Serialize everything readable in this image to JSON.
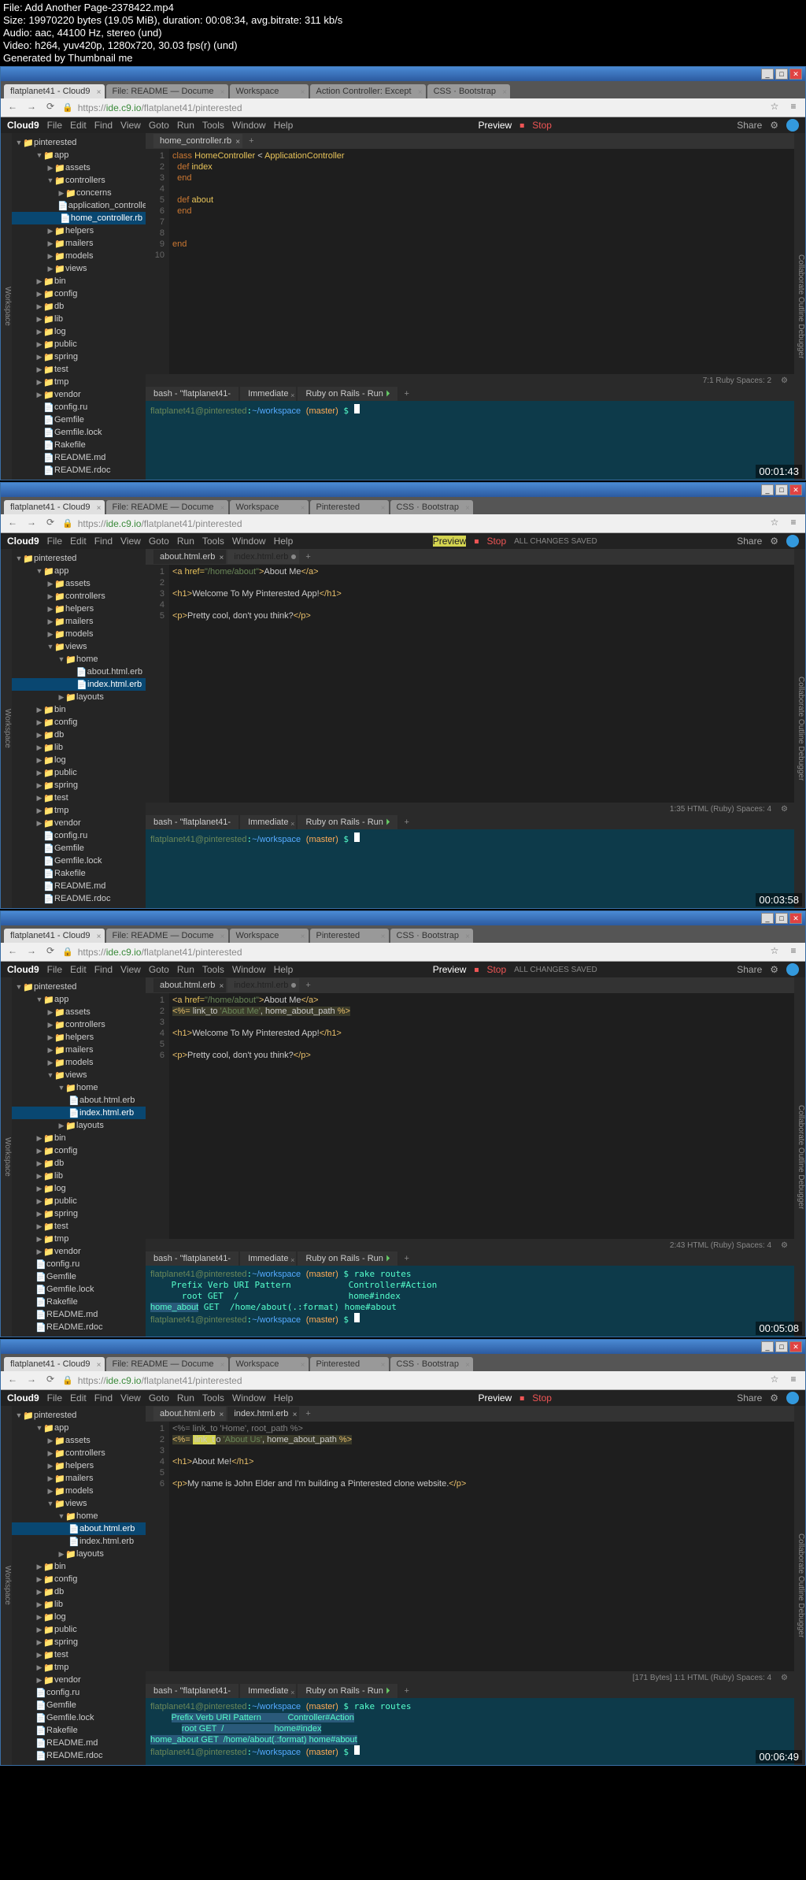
{
  "fileinfo": {
    "l1": "File: Add Another Page-2378422.mp4",
    "l2": "Size: 19970220 bytes (19.05 MiB), duration: 00:08:34, avg.bitrate: 311 kb/s",
    "l3": "Audio: aac, 44100 Hz, stereo (und)",
    "l4": "Video: h264, yuv420p, 1280x720, 30.03 fps(r) (und)",
    "l5": "Generated by Thumbnail me"
  },
  "common": {
    "browsertabs": [
      {
        "label": "flatplanet41 - Cloud9"
      },
      {
        "label": "File: README — Docume"
      },
      {
        "label": "Workspace"
      },
      {
        "label": "Action Controller: Except"
      },
      {
        "label": "CSS · Bootstrap"
      }
    ],
    "browsertabs_b": [
      {
        "label": "flatplanet41 - Cloud9"
      },
      {
        "label": "File: README — Docume"
      },
      {
        "label": "Workspace"
      },
      {
        "label": "Pinterested"
      },
      {
        "label": "CSS · Bootstrap"
      }
    ],
    "url_prefix": "https://",
    "url_host": "ide.c9.io",
    "url_path": "/flatplanet41/pinterested",
    "menu": [
      "File",
      "Edit",
      "Find",
      "View",
      "Goto",
      "Run",
      "Tools",
      "Window",
      "Help"
    ],
    "logo": "Cloud9",
    "preview": "Preview",
    "run": "Run",
    "stop": "Stop",
    "share": "Share",
    "saved": "ALL CHANGES SAVED ",
    "winbtns": {
      "min": "_",
      "max": "□",
      "close": "✕"
    }
  },
  "tree": {
    "root": "pinterested",
    "app": "app",
    "assets": "assets",
    "controllers": "controllers",
    "concerns": "concerns",
    "appctrl": "application_controlle",
    "homectrl": "home_controller.rb",
    "helpers": "helpers",
    "mailers": "mailers",
    "models": "models",
    "views": "views",
    "home": "home",
    "about_erb": "about.html.erb",
    "index_erb": "index.html.erb",
    "layouts": "layouts",
    "bin": "bin",
    "config": "config",
    "db": "db",
    "lib": "lib",
    "log": "log",
    "public": "public",
    "spring": "spring",
    "test": "test",
    "tmp": "tmp",
    "vendor": "vendor",
    "configru": "config.ru",
    "gemfile": "Gemfile",
    "gemlock": "Gemfile.lock",
    "rakefile": "Rakefile",
    "readmemd": "README.md",
    "readmerdoc": "README.rdoc"
  },
  "f1": {
    "timestamp": "00:01:43",
    "edtab": "home_controller.rb",
    "code": {
      "1": "class HomeController < ApplicationController",
      "2": "  def index",
      "3": "  end",
      "4": "",
      "5": "  def about",
      "6": "  end",
      "7": "",
      "8": "",
      "9": "end",
      "10": ""
    },
    "status": "7:1   Ruby   Spaces: 2",
    "termtabs": [
      "bash - \"flatplanet41-",
      "Immediate",
      "Ruby on Rails - Run"
    ],
    "term": "flatplanet41@pinterested:~/workspace (master) $ "
  },
  "f2": {
    "timestamp": "00:03:58",
    "edtabs": [
      "about.html.erb",
      "index.html.erb"
    ],
    "code": {
      "1": "<a href=\"/home/about\">About Me</a>",
      "2": "",
      "3": "<h1>Welcome To My Pinterested App!</h1>",
      "4": "",
      "5": "<p>Pretty cool, don't you think?</p>"
    },
    "status": "1:35   HTML (Ruby)   Spaces: 4",
    "termtabs": [
      "bash - \"flatplanet41-",
      "Immediate",
      "Ruby on Rails - Run"
    ],
    "term": "flatplanet41@pinterested:~/workspace (master) $ "
  },
  "f3": {
    "timestamp": "00:05:08",
    "edtabs": [
      "about.html.erb",
      "index.html.erb"
    ],
    "code": {
      "1": "<a href=\"/home/about\">About Me</a>",
      "2": "<%= link_to 'About Me', home_about_path %>",
      "3": "",
      "4": "<h1>Welcome To My Pinterested App!</h1>",
      "5": "",
      "6": "<p>Pretty cool, don't you think?</p>"
    },
    "status": "2:43   HTML (Ruby)   Spaces: 4",
    "termtabs": [
      "bash - \"flatplanet41-",
      "Immediate",
      "Ruby on Rails - Run"
    ],
    "term": {
      "l1": "flatplanet41@pinterested:~/workspace (master) $ rake routes",
      "l2": "    Prefix Verb URI Pattern           Controller#Action",
      "l3": "      root GET  /                     home#index",
      "l4": "home_about GET  /home/about(.:format) home#about",
      "l5": "flatplanet41@pinterested:~/workspace (master) $ "
    }
  },
  "f4": {
    "timestamp": "00:06:49",
    "edtabs": [
      "about.html.erb",
      "index.html.erb"
    ],
    "code": {
      "1": "<%= link_to 'Home', root_path %>",
      "2": "<%= link_to 'About Us', home_about_path %>",
      "3": "",
      "4": "<h1>About Me!</h1>",
      "5": "",
      "6": "<p>My name is John Elder and I'm building a Pinterested clone website.</p>"
    },
    "status": "[171 Bytes]   1:1   HTML (Ruby)   Spaces: 4",
    "termtabs": [
      "bash - \"flatplanet41-",
      "Immediate",
      "Ruby on Rails - Run"
    ],
    "term": {
      "l1": "flatplanet41@pinterested:~/workspace (master) $ rake routes",
      "l2": "    Prefix Verb URI Pattern           Controller#Action",
      "l3": "      root GET  /                     home#index",
      "l4": "home_about GET  /home/about(.:format) home#about",
      "l5": "flatplanet41@pinterested:~/workspace (master) $ "
    }
  }
}
